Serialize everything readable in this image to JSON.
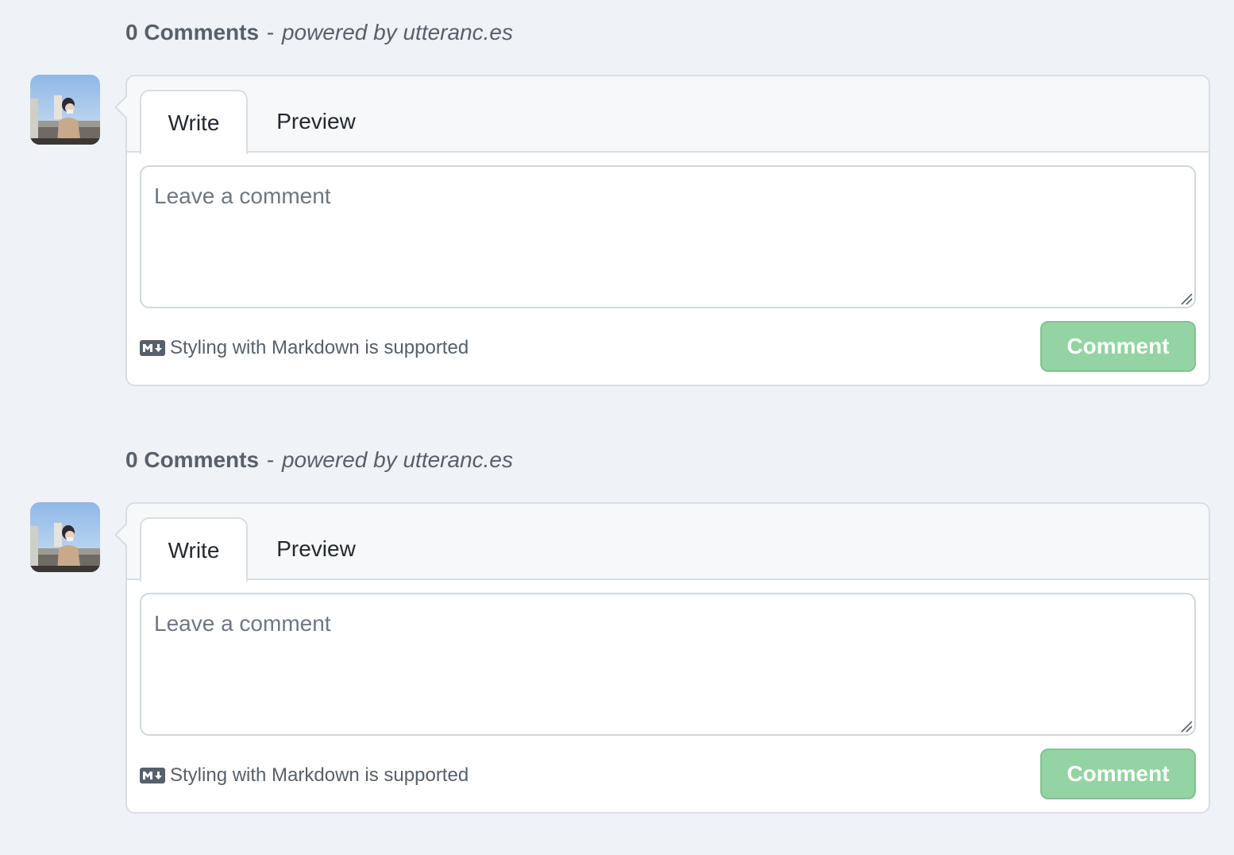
{
  "threads": [
    {
      "header": {
        "count": "0 Comments",
        "separator": "-",
        "powered_by": "powered by utteranc.es"
      },
      "tabs": {
        "write": "Write",
        "preview": "Preview"
      },
      "textarea": {
        "placeholder": "Leave a comment",
        "value": ""
      },
      "markdown_hint": "Styling with Markdown is supported",
      "submit_label": "Comment"
    },
    {
      "header": {
        "count": "0 Comments",
        "separator": "-",
        "powered_by": "powered by utteranc.es"
      },
      "tabs": {
        "write": "Write",
        "preview": "Preview"
      },
      "textarea": {
        "placeholder": "Leave a comment",
        "value": ""
      },
      "markdown_hint": "Styling with Markdown is supported",
      "submit_label": "Comment"
    }
  ],
  "icons": {
    "markdown": "markdown-icon",
    "avatar": "user-avatar",
    "resize": "resize-grip-icon"
  },
  "colors": {
    "background": "#eff2f6",
    "submit_disabled": "#94d3a2",
    "border": "#d8dee4"
  }
}
